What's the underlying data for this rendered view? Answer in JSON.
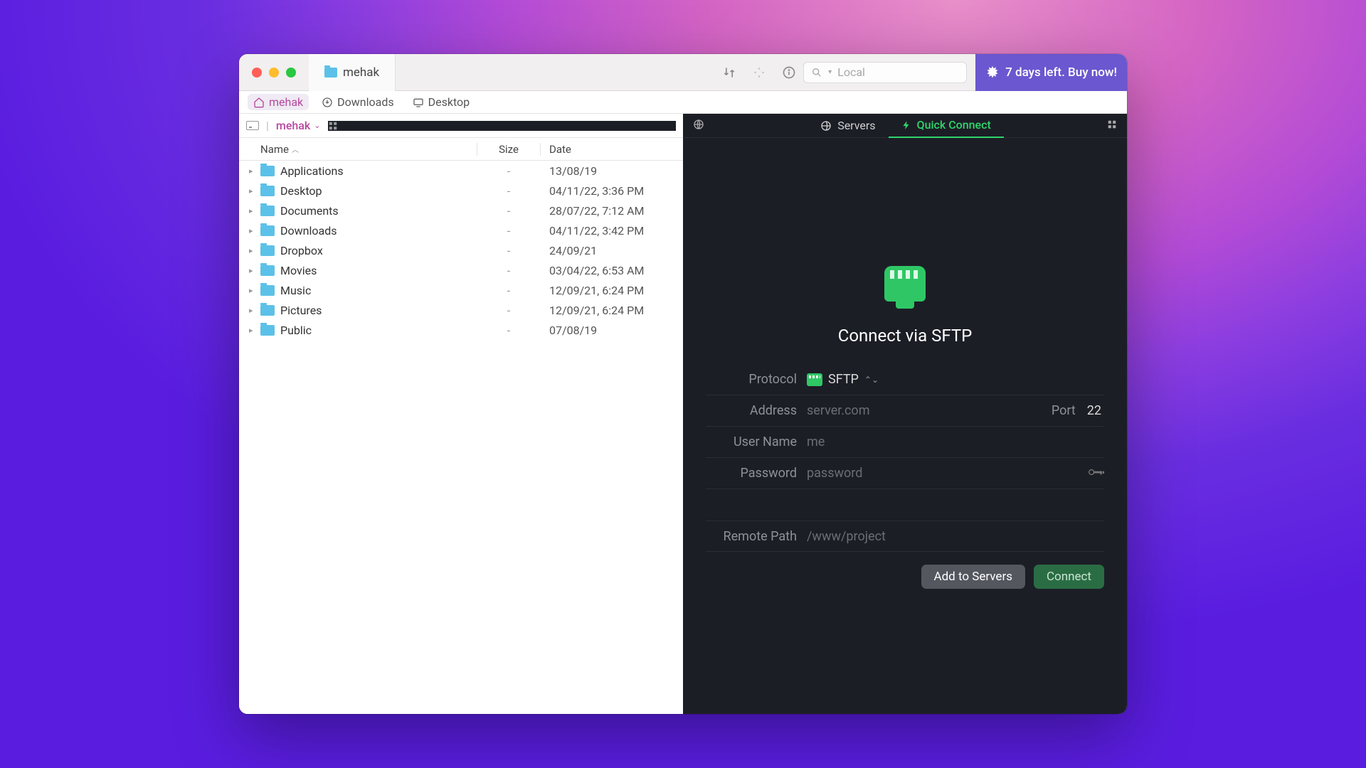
{
  "titlebar": {
    "tab_label": "mehak"
  },
  "toolbar": {
    "search_placeholder": "Local",
    "buy_text": "7 days left. Buy now!"
  },
  "favorites": [
    {
      "label": "mehak",
      "icon": "home",
      "active": true
    },
    {
      "label": "Downloads",
      "icon": "download",
      "active": false
    },
    {
      "label": "Desktop",
      "icon": "desktop",
      "active": false
    }
  ],
  "breadcrumb": {
    "current": "mehak"
  },
  "columns": {
    "name": "Name",
    "size": "Size",
    "date": "Date"
  },
  "files": [
    {
      "name": "Applications",
      "size": "-",
      "date": "13/08/19"
    },
    {
      "name": "Desktop",
      "size": "-",
      "date": "04/11/22, 3:36 PM"
    },
    {
      "name": "Documents",
      "size": "-",
      "date": "28/07/22, 7:12 AM"
    },
    {
      "name": "Downloads",
      "size": "-",
      "date": "04/11/22, 3:42 PM"
    },
    {
      "name": "Dropbox",
      "size": "-",
      "date": "24/09/21"
    },
    {
      "name": "Movies",
      "size": "-",
      "date": "03/04/22, 6:53 AM"
    },
    {
      "name": "Music",
      "size": "-",
      "date": "12/09/21, 6:24 PM"
    },
    {
      "name": "Pictures",
      "size": "-",
      "date": "12/09/21, 6:24 PM"
    },
    {
      "name": "Public",
      "size": "-",
      "date": "07/08/19"
    }
  ],
  "remote_tabs": {
    "servers": "Servers",
    "quick": "Quick Connect"
  },
  "quick_connect": {
    "title": "Connect via SFTP",
    "labels": {
      "protocol": "Protocol",
      "address": "Address",
      "port": "Port",
      "username": "User Name",
      "password": "Password",
      "remote_path": "Remote Path"
    },
    "values": {
      "protocol": "SFTP",
      "port": "22"
    },
    "placeholders": {
      "address": "server.com",
      "username": "me",
      "password": "password",
      "remote_path": "/www/project"
    },
    "buttons": {
      "add": "Add to Servers",
      "connect": "Connect"
    }
  }
}
